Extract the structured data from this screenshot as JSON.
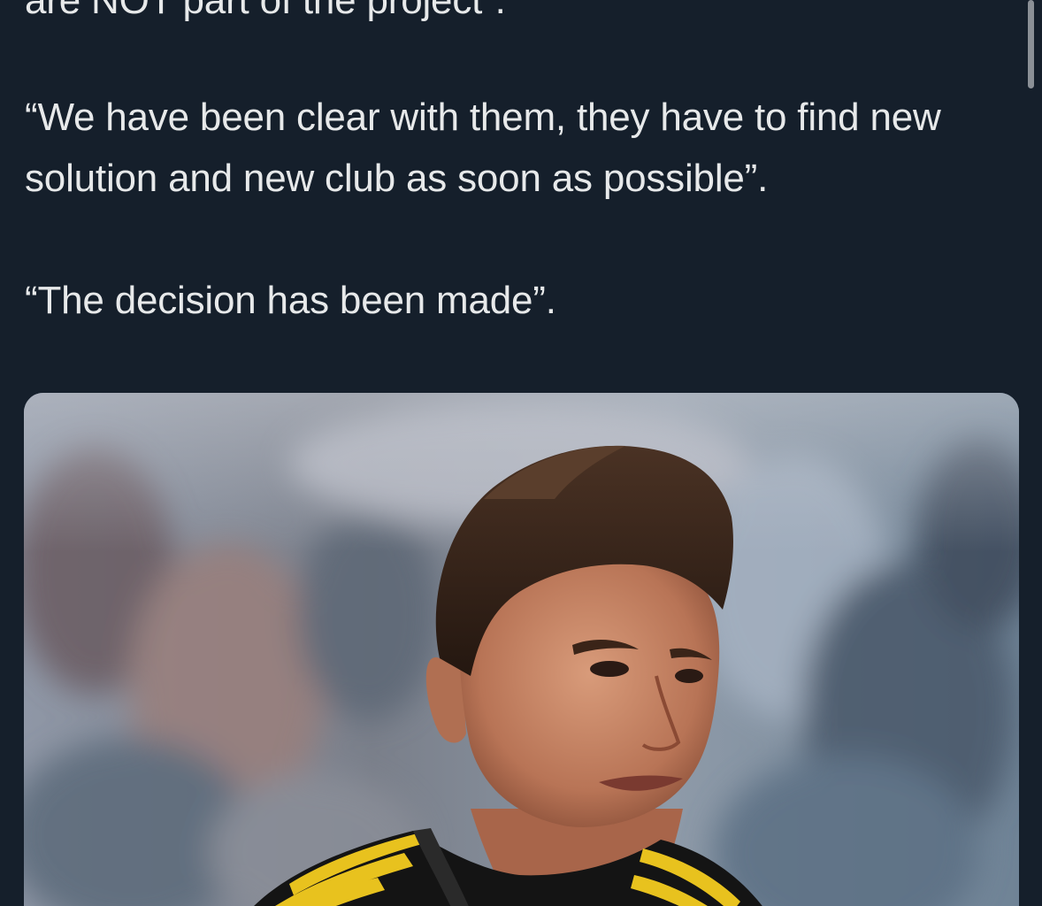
{
  "tweet": {
    "cut_line": "are NOT part of the project”.",
    "paragraphs": [
      "“We have been clear with them, they have to find new solution and new club as soon as possible”.",
      "“The decision has been made”."
    ]
  },
  "media": {
    "description_name": "footballer-photo"
  },
  "colors": {
    "background": "#151f2b",
    "text": "#e7e9ea",
    "scrollbar": "#8b9096",
    "kit_yellow": "#e8c21e",
    "kit_black": "#141414"
  }
}
